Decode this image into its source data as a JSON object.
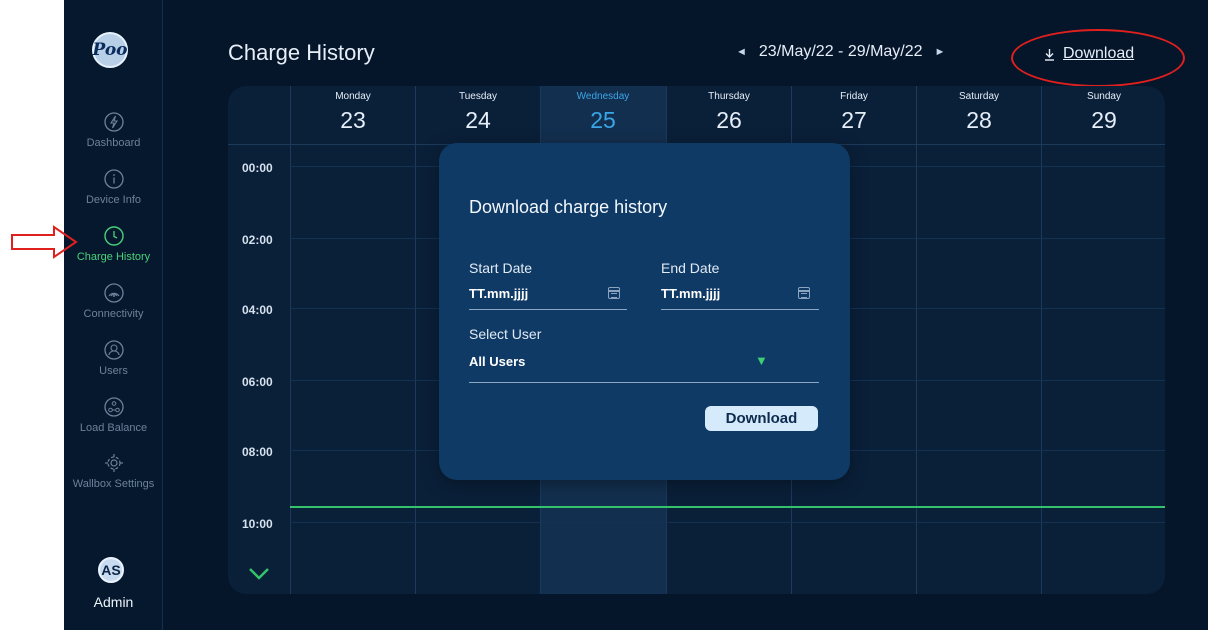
{
  "app": {
    "title": "Charge History",
    "date_range": "23/May/22 - 29/May/22",
    "prev_arrow": "◄",
    "next_arrow": "►",
    "download_label": "Download",
    "download_icon": "download-arrow-icon"
  },
  "sidebar": {
    "logo_text": "Poo",
    "items": [
      {
        "label": "Dashboard",
        "icon": "lightning-icon",
        "active": false
      },
      {
        "label": "Device Info",
        "icon": "info-icon",
        "active": false
      },
      {
        "label": "Charge History",
        "icon": "clock-icon",
        "active": true
      },
      {
        "label": "Connectivity",
        "icon": "signal-icon",
        "active": false
      },
      {
        "label": "Users",
        "icon": "user-icon",
        "active": false
      },
      {
        "label": "Load Balance",
        "icon": "balance-icon",
        "active": false
      },
      {
        "label": "Wallbox Settings",
        "icon": "gear-icon",
        "active": false
      }
    ],
    "user_initials": "AS",
    "user_name": "Admin"
  },
  "calendar": {
    "days": [
      {
        "name": "Monday",
        "num": "23",
        "today": false
      },
      {
        "name": "Tuesday",
        "num": "24",
        "today": false
      },
      {
        "name": "Wednesday",
        "num": "25",
        "today": true
      },
      {
        "name": "Thursday",
        "num": "26",
        "today": false
      },
      {
        "name": "Friday",
        "num": "27",
        "today": false
      },
      {
        "name": "Saturday",
        "num": "28",
        "today": false
      },
      {
        "name": "Sunday",
        "num": "29",
        "today": false
      }
    ],
    "times": [
      "00:00",
      "02:00",
      "04:00",
      "06:00",
      "08:00",
      "10:00"
    ]
  },
  "modal": {
    "title": "Download charge history",
    "start_label": "Start Date",
    "start_value": "TT.mm.jjjj",
    "end_label": "End Date",
    "end_value": "TT.mm.jjjj",
    "user_label": "Select User",
    "user_value": "All Users",
    "button": "Download"
  },
  "colors": {
    "background": "#05152a",
    "accent_green": "#34c26a",
    "today_blue": "#3aa6e8",
    "modal_bg": "#0f3a66",
    "annotation_red": "#e0201e"
  }
}
